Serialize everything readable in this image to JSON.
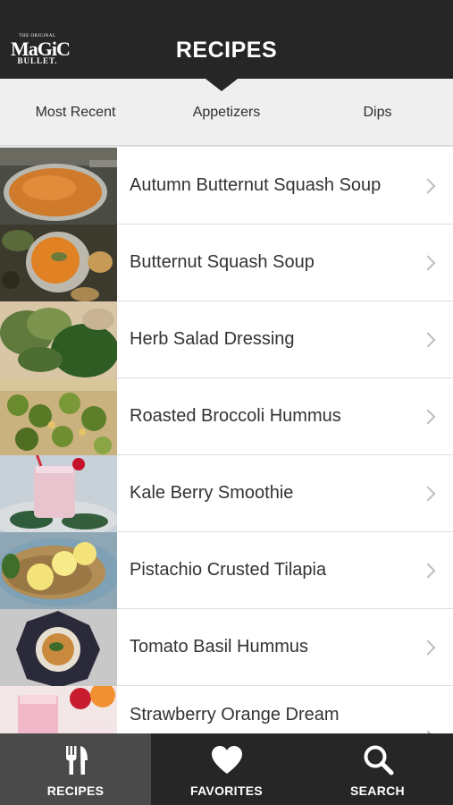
{
  "header": {
    "logo": {
      "line1": "THE ORIGINAL",
      "line2": "MaGiC",
      "line3": "BULLET."
    },
    "title": "RECIPES"
  },
  "tabs": [
    {
      "label": "Most Recent"
    },
    {
      "label": "Appetizers"
    },
    {
      "label": "Dips"
    }
  ],
  "recipes": [
    {
      "title": "Autumn Butternut Squash Soup"
    },
    {
      "title": "Butternut Squash Soup"
    },
    {
      "title": "Herb Salad Dressing"
    },
    {
      "title": "Roasted Broccoli Hummus"
    },
    {
      "title": "Kale Berry Smoothie"
    },
    {
      "title": "Pistachio Crusted Tilapia"
    },
    {
      "title": "Tomato Basil Hummus"
    },
    {
      "title": "Strawberry Orange Dream"
    }
  ],
  "tabbar": [
    {
      "label": "RECIPES",
      "icon": "fork-knife-icon",
      "active": true
    },
    {
      "label": "FAVORITES",
      "icon": "heart-icon",
      "active": false
    },
    {
      "label": "SEARCH",
      "icon": "search-icon",
      "active": false
    }
  ],
  "colors": {
    "header_bg": "#262626",
    "tabs_bg": "#efefef",
    "active_tab_bg": "#4a4a4a",
    "text": "#333333",
    "chevron": "#bdbdbd"
  }
}
